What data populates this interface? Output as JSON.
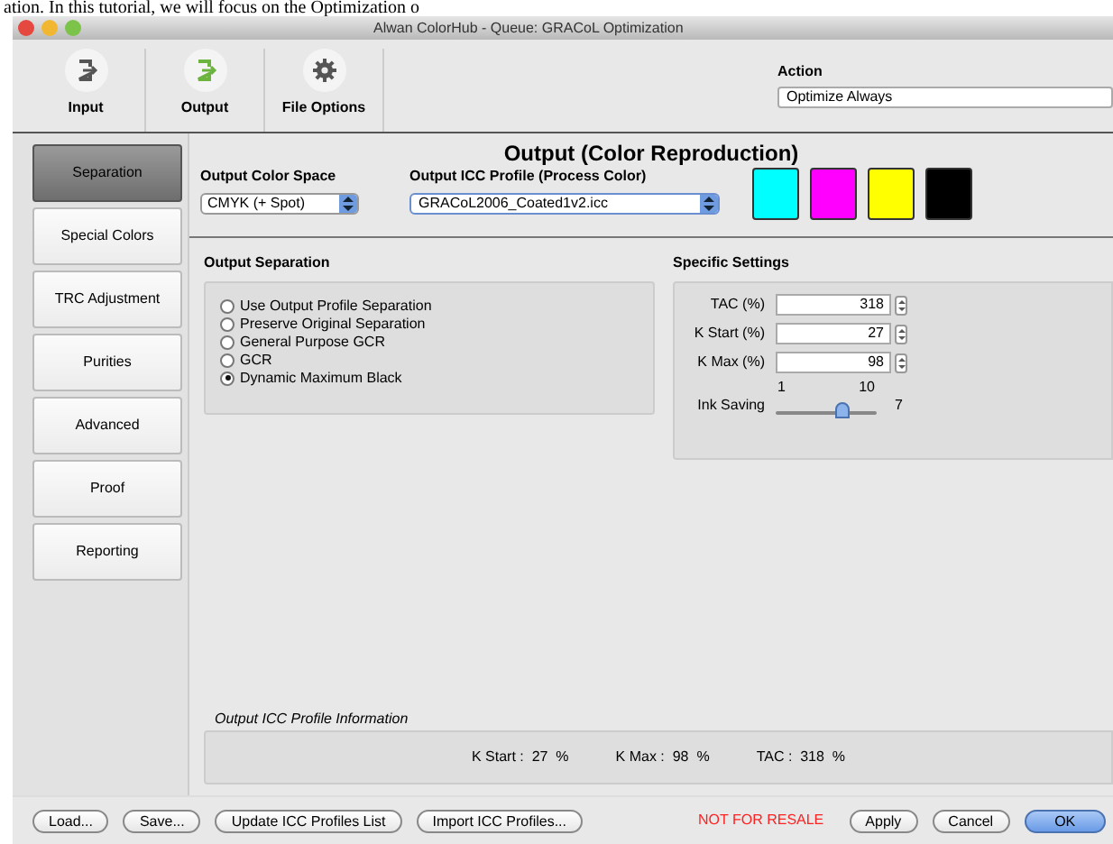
{
  "caption": "ation. In this tutorial, we will focus on the Optimization o",
  "window": {
    "title": "Alwan ColorHub - Queue: GRACoL Optimization"
  },
  "toolbar": [
    {
      "label": "Input",
      "kind": "input"
    },
    {
      "label": "Output",
      "kind": "output"
    },
    {
      "label": "File Options",
      "kind": "gear"
    }
  ],
  "action": {
    "label": "Action",
    "value": "Optimize Always"
  },
  "sidebar": [
    {
      "label": "Separation",
      "selected": true
    },
    {
      "label": "Special Colors",
      "selected": false
    },
    {
      "label": "TRC Adjustment",
      "selected": false
    },
    {
      "label": "Purities",
      "selected": false
    },
    {
      "label": "Advanced",
      "selected": false
    },
    {
      "label": "Proof",
      "selected": false
    },
    {
      "label": "Reporting",
      "selected": false
    }
  ],
  "section_title": "Output (Color Reproduction)",
  "output_color_space": {
    "label": "Output Color Space",
    "value": "CMYK (+ Spot)"
  },
  "output_icc_profile": {
    "label": "Output ICC Profile (Process Color)",
    "value": "GRACoL2006_Coated1v2.icc"
  },
  "swatches": [
    {
      "color": "#00ffff"
    },
    {
      "color": "#ff00ff"
    },
    {
      "color": "#ffff00"
    },
    {
      "color": "#000000"
    }
  ],
  "output_separation": {
    "title": "Output Separation",
    "options": [
      {
        "label": "Use Output Profile Separation",
        "selected": false
      },
      {
        "label": "Preserve Original Separation",
        "selected": false
      },
      {
        "label": "General Purpose GCR",
        "selected": false
      },
      {
        "label": "GCR",
        "selected": false
      },
      {
        "label": "Dynamic Maximum Black",
        "selected": true
      }
    ]
  },
  "specific_settings": {
    "title": "Specific Settings",
    "fields": [
      {
        "label": "TAC (%)",
        "value": "318"
      },
      {
        "label": "K Start (%)",
        "value": "27"
      },
      {
        "label": "K Max (%)",
        "value": "98"
      }
    ],
    "ink_saving": {
      "label": "Ink Saving",
      "min": "1",
      "max": "10",
      "reading": "7",
      "level": 0.667
    }
  },
  "profile_info": {
    "title": "Output ICC Profile Information",
    "items": [
      "K Start :  27  %",
      "K Max :  98  %",
      "TAC :  318  %"
    ]
  },
  "footer": {
    "left_buttons": [
      "Load...",
      "Save...",
      "Update ICC Profiles List",
      "Import ICC Profiles..."
    ],
    "notice": "NOT FOR RESALE",
    "right_buttons": [
      {
        "label": "Apply",
        "default": false
      },
      {
        "label": "Cancel",
        "default": false
      },
      {
        "label": "OK",
        "default": true
      }
    ]
  }
}
